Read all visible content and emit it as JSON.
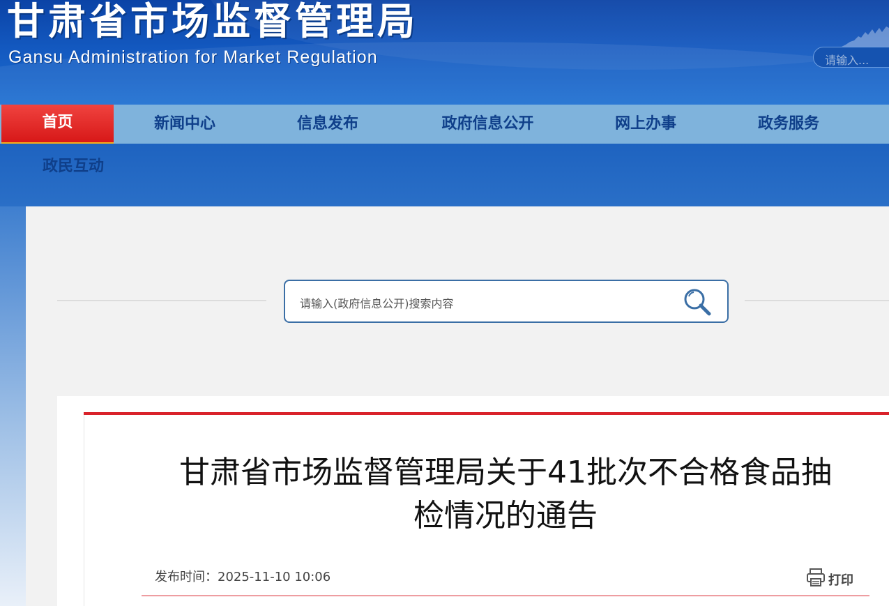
{
  "header": {
    "title_cn": "甘肃省市场监督管理局",
    "title_en": "Gansu Administration for Market Regulation",
    "search_placeholder": "请输入..."
  },
  "nav": {
    "items": [
      {
        "label": "首页",
        "active": true
      },
      {
        "label": "新闻中心"
      },
      {
        "label": "信息发布"
      },
      {
        "label": "政府信息公开"
      },
      {
        "label": "网上办事"
      },
      {
        "label": "政务服务"
      },
      {
        "label": "政民互动"
      }
    ]
  },
  "search": {
    "placeholder": "请输入(政府信息公开)搜索内容"
  },
  "article": {
    "title_line1": "甘肃省市场监督管理局关于41批次不合格食品抽",
    "title_line2": "检情况的通告",
    "publish_label": "发布时间：",
    "publish_time": "2025-11-10 10:06",
    "print_label": "打印"
  },
  "colors": {
    "header_blue": "#1358bf",
    "nav_blue": "#7fb3dc",
    "active_red": "#d71818",
    "accent_red": "#d9222a"
  }
}
